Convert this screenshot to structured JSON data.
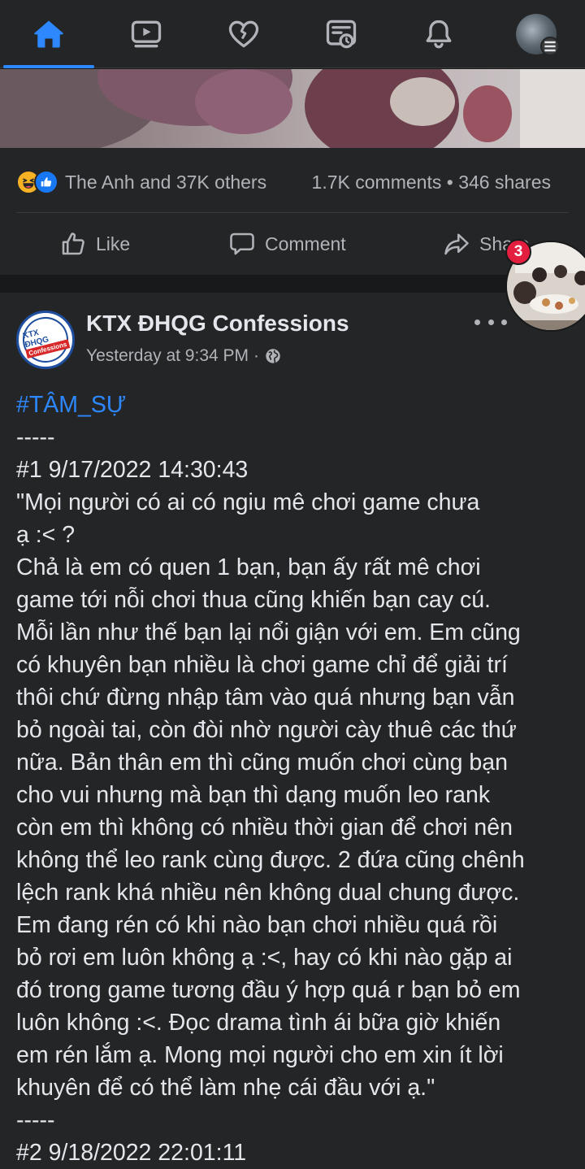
{
  "nav": {
    "tabs": [
      {
        "name": "home",
        "icon": "home-icon",
        "active": true
      },
      {
        "name": "watch",
        "icon": "video-icon",
        "active": false
      },
      {
        "name": "dating",
        "icon": "heart-icon",
        "active": false
      },
      {
        "name": "feeds",
        "icon": "feeds-icon",
        "active": false
      },
      {
        "name": "notifications",
        "icon": "bell-icon",
        "active": false
      },
      {
        "name": "menu",
        "icon": "profile-avatar",
        "active": false
      }
    ],
    "accent_color": "#2d88ff"
  },
  "post1": {
    "reactions_text": "The Anh and 37K others",
    "comments": "1.7K comments",
    "separator": "•",
    "shares": "346 shares",
    "actions": {
      "like": "Like",
      "comment": "Comment",
      "share": "Share"
    }
  },
  "chat_head": {
    "badge_count": "3"
  },
  "post2": {
    "page_name": "KTX ĐHQG Confessions",
    "logo_text_top": "KTX ĐHQG",
    "logo_text_band": "Confessions",
    "timestamp": "Yesterday at 9:34 PM",
    "meta_separator": "·",
    "privacy_icon": "globe-icon",
    "hashtag": "#TÂM_SỰ",
    "body_lines": [
      "-----",
      "#1 9/17/2022 14:30:43",
      "\"Mọi người có ai có ngiu mê chơi game chưa",
      "ạ :< ?",
      "Chả là em có quen 1 bạn, bạn ấy rất mê chơi",
      "game tới nỗi chơi thua cũng khiến bạn cay cú.",
      "Mỗi lần như thế bạn lại nổi giận với em. Em cũng",
      "có khuyên bạn nhiều là chơi game chỉ để giải trí",
      "thôi chứ đừng nhập tâm vào quá nhưng bạn vẫn",
      "bỏ ngoài tai, còn đòi nhờ người cày thuê các thứ",
      "nữa. Bản thân em thì cũng muốn chơi cùng bạn",
      "cho vui nhưng mà bạn thì dạng muốn leo rank",
      "còn em thì không có nhiều thời gian để chơi nên",
      "không thể leo rank cùng được. 2 đứa cũng chênh",
      "lệch rank khá nhiều nên không dual chung được.",
      "Em đang rén có khi nào bạn chơi nhiều quá rồi",
      "bỏ rơi em luôn không ạ :<, hay có khi nào gặp ai",
      "đó trong game tương đầu ý hợp quá r bạn bỏ em",
      "luôn không :<. Đọc drama tình ái bữa giờ khiến",
      "em rén lắm ạ. Mong mọi người cho em xin ít lời",
      "khuyên để có thể làm nhẹ cái đầu với ạ.\"",
      "-----",
      "#2 9/18/2022 22:01:11"
    ]
  }
}
